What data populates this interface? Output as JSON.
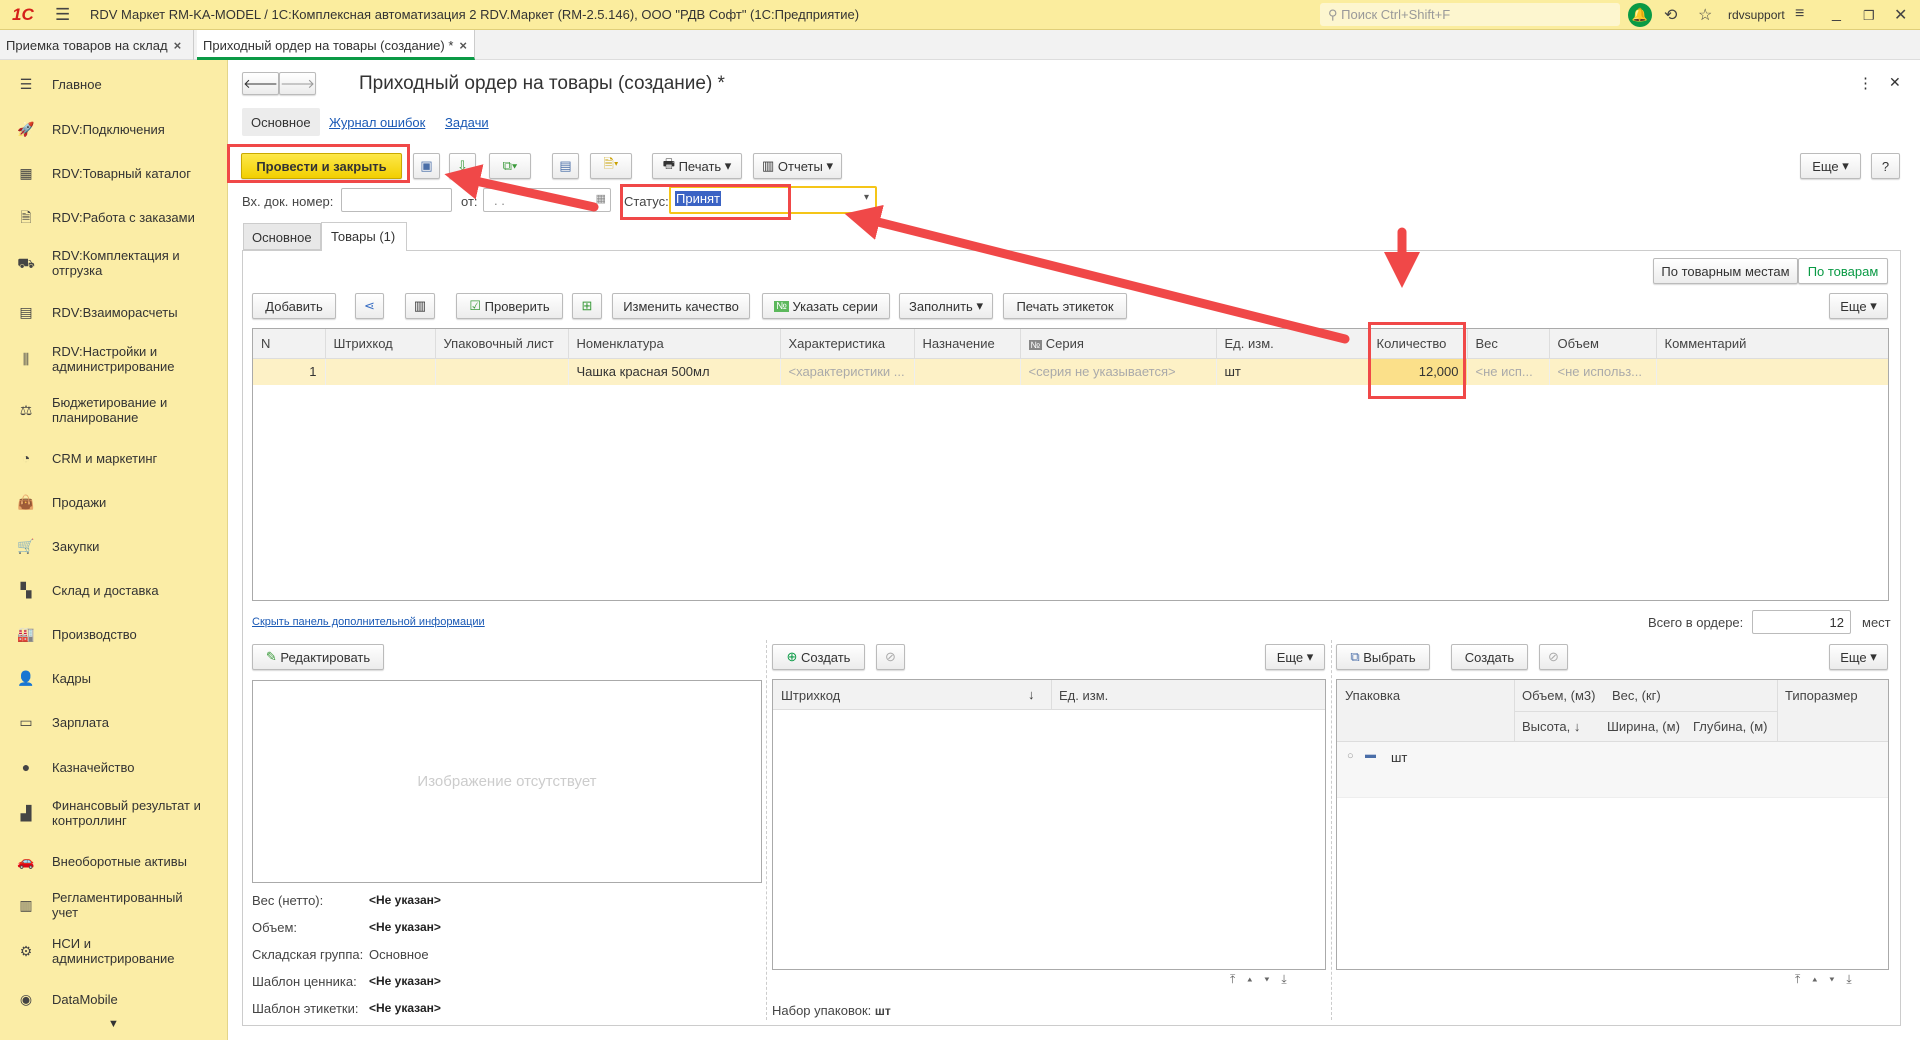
{
  "titlebar": {
    "logo": "1С",
    "title": "RDV Маркет RM-KA-MODEL / 1С:Комплексная автоматизация 2 RDV.Маркет (RM-2.5.146), ООО \"РДВ Софт\"  (1С:Предприятие)",
    "search_placeholder": "Поиск Ctrl+Shift+F",
    "user": "rdvsupport"
  },
  "window_tabs": [
    {
      "label": "Приемка товаров на склад"
    },
    {
      "label": "Приходный ордер на товары (создание) *"
    }
  ],
  "sidebar": {
    "items": [
      {
        "label": "Главное",
        "icon": "menu-icon"
      },
      {
        "label": "RDV:Подключения",
        "icon": "rocket-icon"
      },
      {
        "label": "RDV:Товарный каталог",
        "icon": "grid-icon"
      },
      {
        "label": "RDV:Работа с заказами",
        "icon": "document-icon"
      },
      {
        "label": "RDV:Комплектация и отгрузка",
        "icon": "dolly-icon"
      },
      {
        "label": "RDV:Взаиморасчеты",
        "icon": "calculator-icon"
      },
      {
        "label": "RDV:Настройки и администрирование",
        "icon": "sliders-icon"
      },
      {
        "label": "Бюджетирование и планирование",
        "icon": "budget-icon"
      },
      {
        "label": "CRM и маркетинг",
        "icon": "pie-icon"
      },
      {
        "label": "Продажи",
        "icon": "bag-icon"
      },
      {
        "label": "Закупки",
        "icon": "cart-icon"
      },
      {
        "label": "Склад и доставка",
        "icon": "warehouse-icon"
      },
      {
        "label": "Производство",
        "icon": "factory-icon"
      },
      {
        "label": "Кадры",
        "icon": "person-icon"
      },
      {
        "label": "Зарплата",
        "icon": "card-icon"
      },
      {
        "label": "Казначейство",
        "icon": "coin-icon"
      },
      {
        "label": "Финансовый результат и контроллинг",
        "icon": "bar-chart-icon"
      },
      {
        "label": "Внеоборотные активы",
        "icon": "car-icon"
      },
      {
        "label": "Регламентированный учет",
        "icon": "ledger-icon"
      },
      {
        "label": "НСИ и администрирование",
        "icon": "gear-icon"
      },
      {
        "label": "DataMobile",
        "icon": "datamobile-icon"
      }
    ]
  },
  "form": {
    "title": "Приходный ордер на товары (создание) *",
    "subtabs": [
      {
        "label": "Основное"
      },
      {
        "label": "Журнал ошибок"
      },
      {
        "label": "Задачи"
      }
    ],
    "toolbar": {
      "post_close": "Провести и закрыть",
      "print": "Печать",
      "reports": "Отчеты",
      "more": "Еще",
      "help": "?"
    },
    "in_doc_label": "Вх. док. номер:",
    "in_doc_value": "",
    "from_label": "от:",
    "from_value": " .  .",
    "status_label": "Статус:",
    "status_value": "Принят",
    "tabs": [
      {
        "label": "Основное"
      },
      {
        "label": "Товары (1)"
      }
    ]
  },
  "goods": {
    "view_by_places": "По товарным местам",
    "view_by_goods": "По товарам",
    "toolbar": {
      "add": "Добавить",
      "check": "Проверить",
      "change_quality": "Изменить качество",
      "set_series": "Указать серии",
      "fill": "Заполнить",
      "print_labels": "Печать этикеток",
      "more": "Еще"
    },
    "columns": [
      "N",
      "Штрихкод",
      "Упаковочный лист",
      "Номенклатура",
      "Характеристика",
      "Назначение",
      "Серия",
      "Ед. изм.",
      "Количество",
      "Вес",
      "Объем",
      "Комментарий"
    ],
    "rows": [
      {
        "n": "1",
        "barcode": "",
        "pack_list": "",
        "item": "Чашка красная 500мл",
        "characteristic": "<характеристики ...",
        "purpose": "",
        "series": "<серия не указывается>",
        "unit": "шт",
        "qty": "12,000",
        "weight": "<не исп...",
        "volume": "<не использ...",
        "comment": ""
      }
    ],
    "hide_panel_link": "Скрыть панель дополнительной информации",
    "total_label": "Всего в ордере:",
    "total_value": "12",
    "total_unit": "мест"
  },
  "info": {
    "edit": "Редактировать",
    "no_image": "Изображение отсутствует",
    "props": [
      {
        "label": "Вес (нетто):",
        "value": "<Не указан>",
        "bold": true
      },
      {
        "label": "Объем:",
        "value": "<Не указан>",
        "bold": true
      },
      {
        "label": "Складская группа:",
        "value": "Основное",
        "bold": false
      },
      {
        "label": "Шаблон ценника:",
        "value": "<Не указан>",
        "bold": true
      },
      {
        "label": "Шаблон этикетки:",
        "value": "<Не указан>",
        "bold": true
      }
    ]
  },
  "barcodes": {
    "create": "Создать",
    "more": "Еще",
    "col_barcode": "Штрихкод",
    "col_unit": "Ед. изм.",
    "pack_set_label": "Набор упаковок:",
    "pack_set_value": "шт"
  },
  "packs": {
    "select": "Выбрать",
    "create": "Создать",
    "more": "Еще",
    "col_pack": "Упаковка",
    "col_volume": "Объем, (м3)",
    "col_weight": "Вес, (кг)",
    "col_size": "Типоразмер",
    "col_height": "Высота,",
    "col_width": "Ширина, (м)",
    "col_depth": "Глубина, (м)",
    "rows": [
      {
        "name": "шт"
      }
    ]
  }
}
